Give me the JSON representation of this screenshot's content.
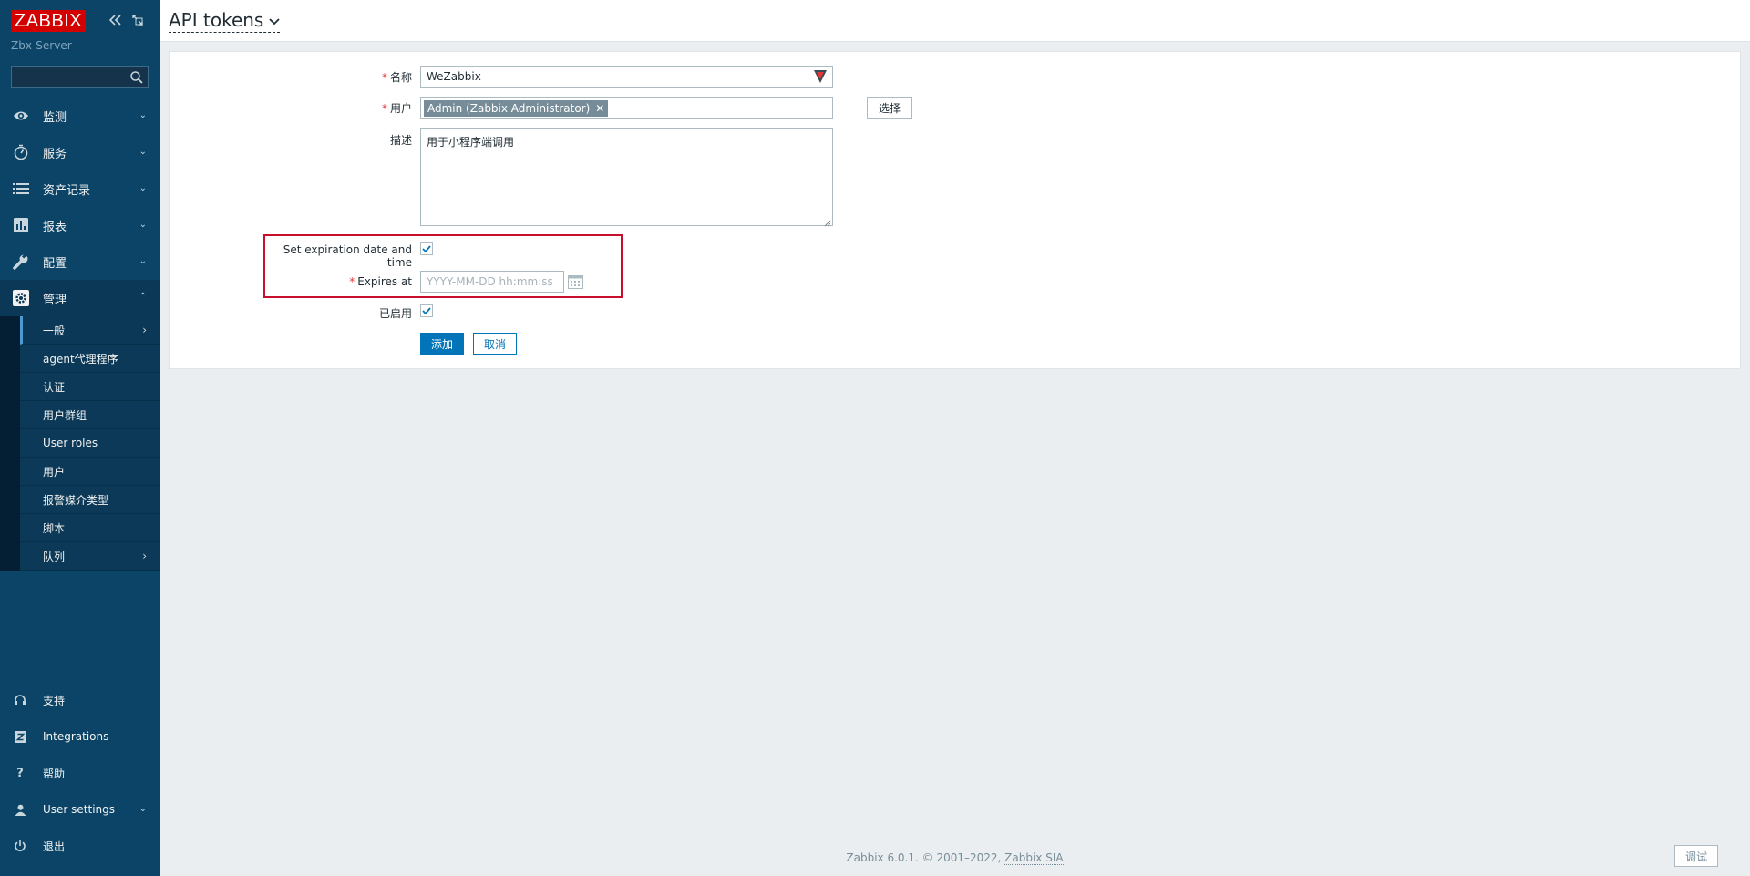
{
  "brand": {
    "logo_text": "ZABBIX",
    "server_name": "Zbx-Server"
  },
  "sidebar": {
    "search_placeholder": "",
    "menu": [
      {
        "label": "监测",
        "icon": "eye-icon"
      },
      {
        "label": "服务",
        "icon": "stopwatch-icon"
      },
      {
        "label": "资产记录",
        "icon": "list-icon"
      },
      {
        "label": "报表",
        "icon": "bar-chart-icon"
      },
      {
        "label": "配置",
        "icon": "wrench-icon"
      },
      {
        "label": "管理",
        "icon": "gear-icon",
        "active": true
      }
    ],
    "submenu": [
      {
        "label": "一般",
        "has_children": true,
        "selected": true
      },
      {
        "label": "agent代理程序"
      },
      {
        "label": "认证"
      },
      {
        "label": "用户群组"
      },
      {
        "label": "User roles"
      },
      {
        "label": "用户"
      },
      {
        "label": "报警媒介类型"
      },
      {
        "label": "脚本"
      },
      {
        "label": "队列",
        "has_children": true
      }
    ],
    "bottom": [
      {
        "label": "支持",
        "icon": "headset-icon"
      },
      {
        "label": "Integrations",
        "icon": "integrations-icon"
      },
      {
        "label": "帮助",
        "icon": "help-icon"
      },
      {
        "label": "User settings",
        "icon": "user-icon"
      },
      {
        "label": "退出",
        "icon": "power-icon"
      }
    ]
  },
  "header": {
    "title": "API tokens"
  },
  "form": {
    "name_label": "名称",
    "name_value": "WeZabbix",
    "user_label": "用户",
    "user_tag": "Admin (Zabbix Administrator)",
    "select_button": "选择",
    "desc_label": "描述",
    "desc_value": "用于小程序端调用",
    "expiration_label": "Set expiration date and time",
    "expires_label": "Expires at",
    "expires_placeholder": "YYYY-MM-DD hh:mm:ss",
    "enabled_label": "已启用",
    "add_button": "添加",
    "cancel_button": "取消"
  },
  "footer": {
    "text": "Zabbix 6.0.1. © 2001–2022, ",
    "link": "Zabbix SIA",
    "debug_button": "调试"
  },
  "colors": {
    "sidebar": "#0b4466",
    "primary": "#0275b8",
    "highlight": "#c8102e",
    "logo": "#d40000"
  }
}
